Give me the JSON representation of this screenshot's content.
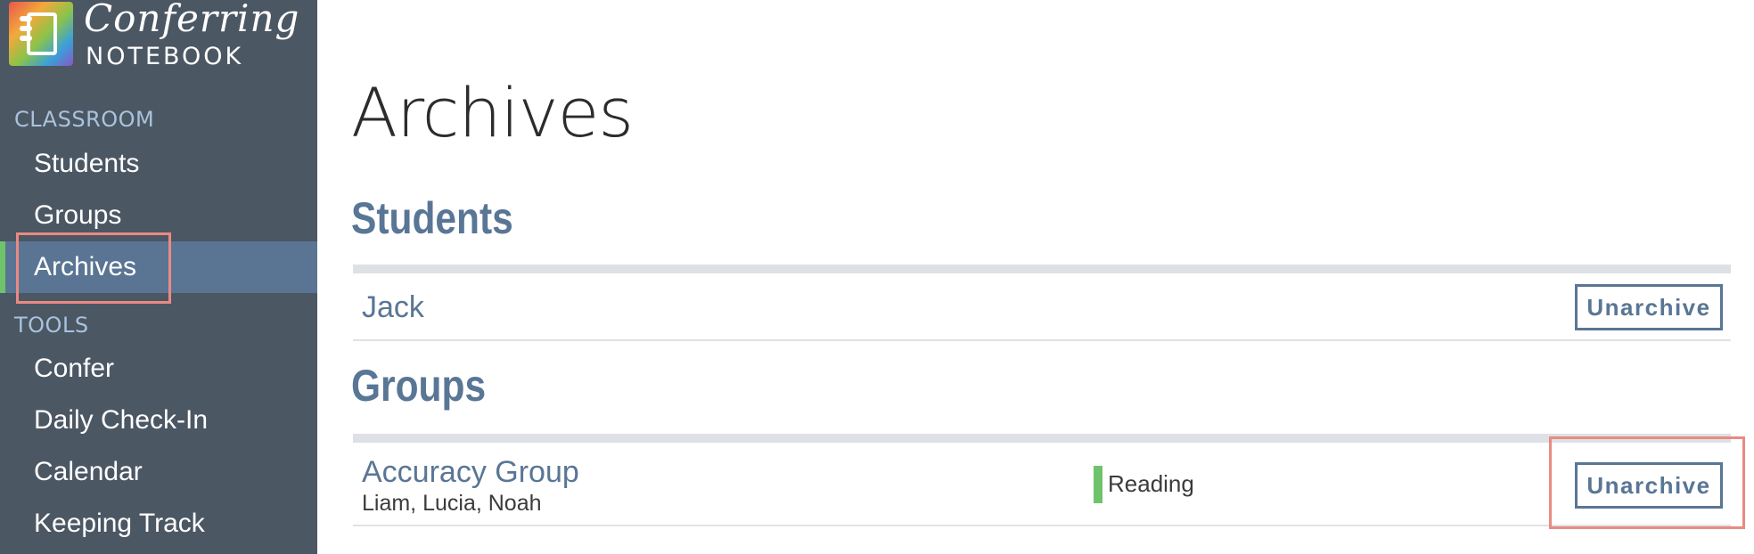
{
  "app": {
    "logo_title": "Conferring",
    "logo_subtitle": "NOTEBOOK"
  },
  "sidebar": {
    "sections": [
      {
        "label": "CLASSROOM",
        "items": [
          {
            "label": "Students",
            "active": false
          },
          {
            "label": "Groups",
            "active": false
          },
          {
            "label": "Archives",
            "active": true
          }
        ]
      },
      {
        "label": "TOOLS",
        "items": [
          {
            "label": "Confer",
            "active": false
          },
          {
            "label": "Daily Check-In",
            "active": false
          },
          {
            "label": "Calendar",
            "active": false
          },
          {
            "label": "Keeping Track",
            "active": false
          }
        ]
      }
    ]
  },
  "main": {
    "title": "Archives",
    "students": {
      "heading": "Students",
      "rows": [
        {
          "name": "Jack",
          "action_label": "Unarchive"
        }
      ]
    },
    "groups": {
      "heading": "Groups",
      "rows": [
        {
          "name": "Accuracy Group",
          "members": "Liam, Lucia, Noah",
          "subject": "Reading",
          "subject_color": "#6fc36b",
          "action_label": "Unarchive"
        }
      ]
    }
  },
  "colors": {
    "sidebar_bg": "#4c5764",
    "active_bg": "#5a7593",
    "active_indicator": "#6fc36b",
    "accent": "#597695",
    "highlight": "#ea8a82"
  }
}
